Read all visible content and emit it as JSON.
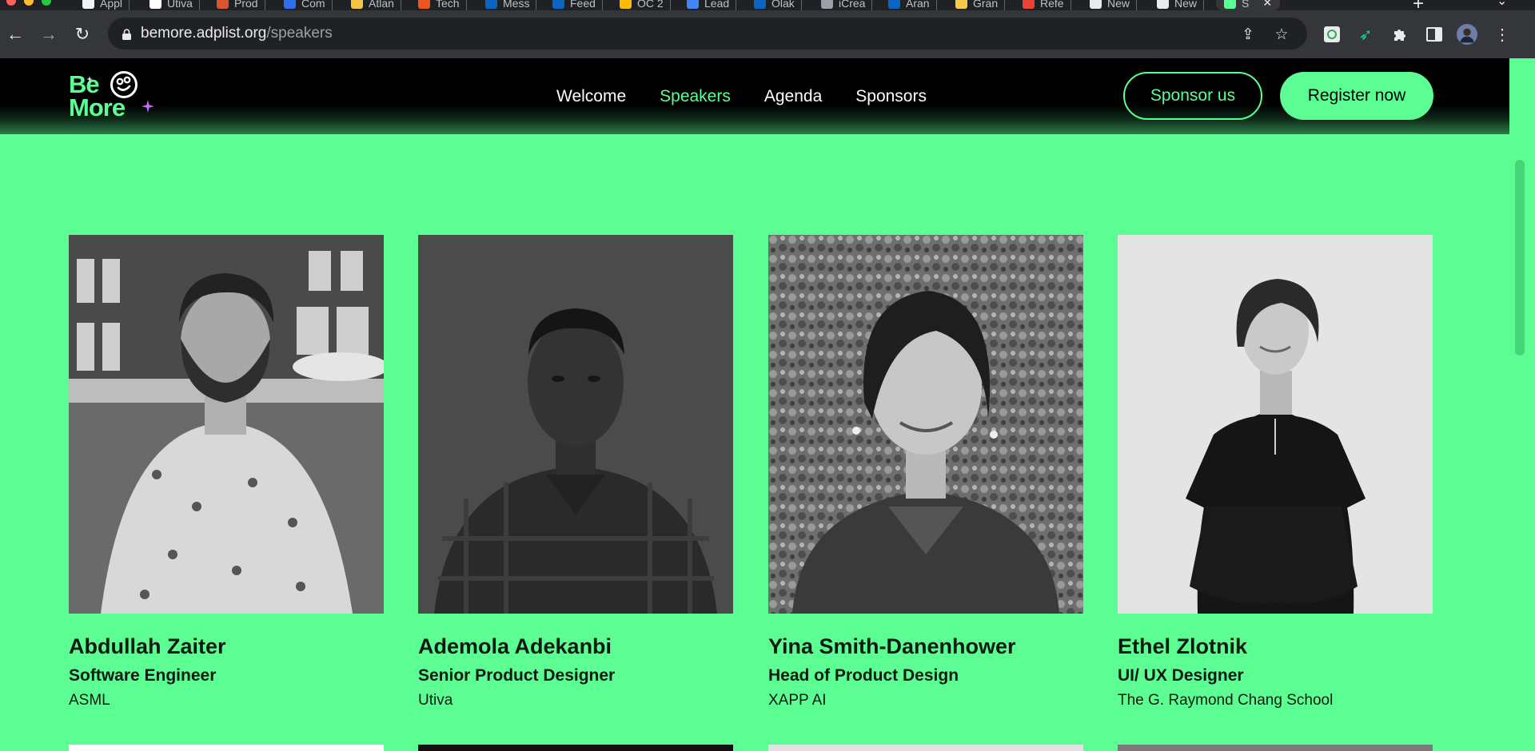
{
  "browser": {
    "tabs": [
      {
        "label": "Appl",
        "favicon_color": "#f1f3f4"
      },
      {
        "label": "Utiva",
        "favicon_color": "#ffffff"
      },
      {
        "label": "Prod",
        "favicon_color": "#da552f"
      },
      {
        "label": "Com",
        "favicon_color": "#2f6fed"
      },
      {
        "label": "Atlan",
        "favicon_color": "#f5c542"
      },
      {
        "label": "Tech",
        "favicon_color": "#e8581c"
      },
      {
        "label": "Mess",
        "favicon_color": "#0a66c2"
      },
      {
        "label": "Feed",
        "favicon_color": "#0a66c2"
      },
      {
        "label": "OC 2",
        "favicon_color": "#fbbc04"
      },
      {
        "label": "Lead",
        "favicon_color": "#4285f4"
      },
      {
        "label": "Olak",
        "favicon_color": "#0a66c2"
      },
      {
        "label": "iCrea",
        "favicon_color": "#9aa0a6"
      },
      {
        "label": "Aran",
        "favicon_color": "#0a66c2"
      },
      {
        "label": "Gran",
        "favicon_color": "#f7c948"
      },
      {
        "label": "Refe",
        "favicon_color": "#ea4335"
      },
      {
        "label": "New",
        "favicon_color": "#e8eaed"
      },
      {
        "label": "New",
        "favicon_color": "#e8eaed"
      },
      {
        "label": "S",
        "favicon_color": "#5cfe93"
      }
    ],
    "url_domain": "bemore.adplist.org",
    "url_path": "/speakers"
  },
  "site": {
    "logo_line1": "Be",
    "logo_line2": "More",
    "nav": [
      "Welcome",
      "Speakers",
      "Agenda",
      "Sponsors"
    ],
    "current_nav": "Speakers",
    "sponsor_label": "Sponsor us",
    "register_label": "Register now",
    "accent_color": "#5cfe93"
  },
  "speakers": [
    {
      "name": "Abdullah Zaiter",
      "role": "Software Engineer",
      "company": "ASML"
    },
    {
      "name": "Ademola Adekanbi",
      "role": "Senior Product Designer",
      "company": "Utiva"
    },
    {
      "name": "Yina Smith-Danenhower",
      "role": "Head of Product Design",
      "company": "XAPP AI"
    },
    {
      "name": "Ethel Zlotnik",
      "role": "UI/ UX Designer",
      "company": "The G. Raymond Chang School"
    }
  ]
}
